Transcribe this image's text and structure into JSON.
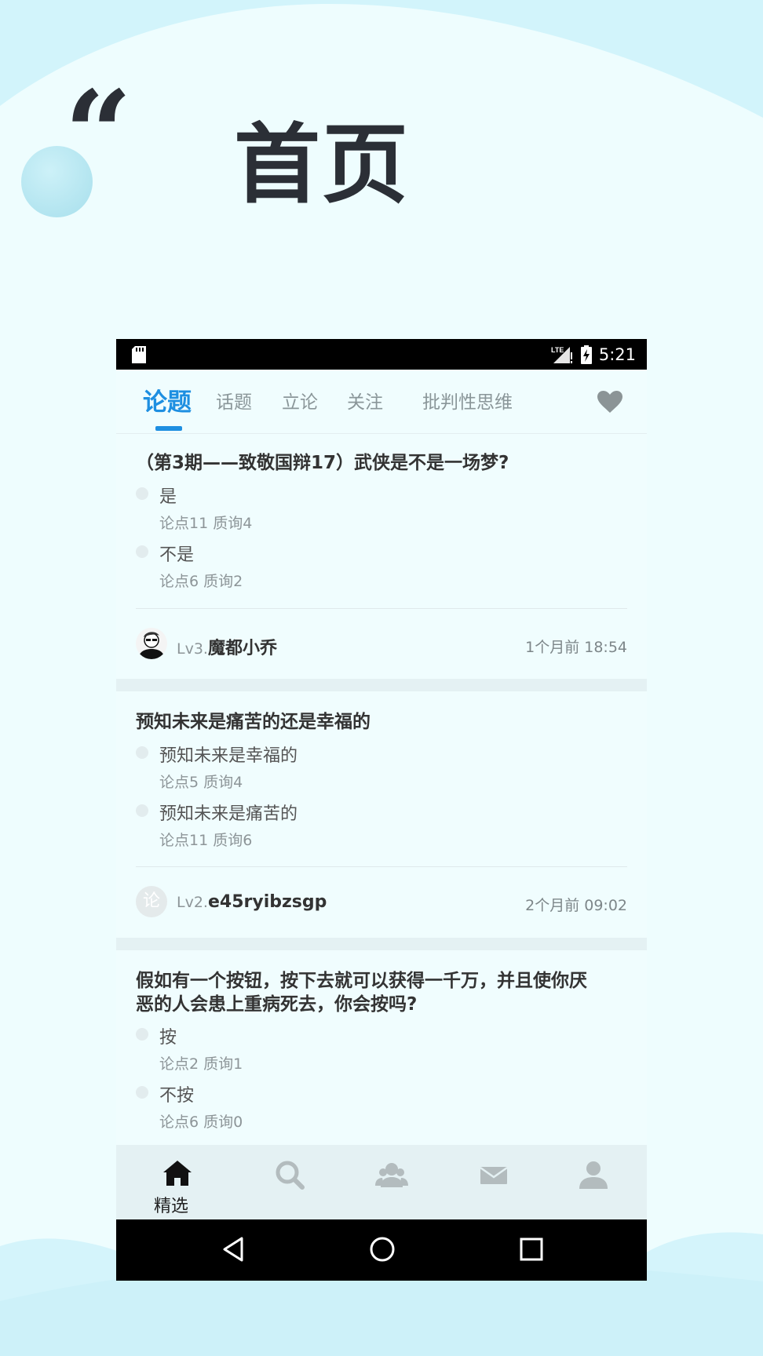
{
  "banner": {
    "quote_mark": "“",
    "title": "首页"
  },
  "status_bar": {
    "network": "LTE",
    "time": "5:21"
  },
  "tabs": [
    {
      "label": "论题",
      "active": true
    },
    {
      "label": "话题",
      "active": false
    },
    {
      "label": "立论",
      "active": false
    },
    {
      "label": "关注",
      "active": false
    },
    {
      "label": "批判性思维",
      "active": false
    }
  ],
  "favorite_icon": "heart-icon",
  "topics": [
    {
      "title": "（第3期——致敬国辩17）武侠是不是一场梦?",
      "options": [
        {
          "label": "是",
          "stats": "论点11 质询4"
        },
        {
          "label": "不是",
          "stats": "论点6 质询2"
        }
      ],
      "author": {
        "level": "Lv3.",
        "name": "魔都小乔"
      },
      "time": "1个月前 18:54"
    },
    {
      "title": "预知未来是痛苦的还是幸福的",
      "options": [
        {
          "label": "预知未来是幸福的",
          "stats": "论点5 质询4"
        },
        {
          "label": "预知未来是痛苦的",
          "stats": "论点11 质询6"
        }
      ],
      "author": {
        "level": "Lv2.",
        "name": "e45ryibzsgp",
        "avatar_char": "论"
      },
      "time": "2个月前 09:02"
    },
    {
      "title_line1": "假如有一个按钮，按下去就可以获得一千万，并且使你厌",
      "title_line2": "恶的人会患上重病死去，你会按吗?",
      "options": [
        {
          "label": "按",
          "stats": "论点2 质询1"
        },
        {
          "label": "不按",
          "stats": "论点6 质询0"
        }
      ]
    }
  ],
  "bottom_nav": [
    {
      "icon": "home-icon",
      "label": "精选",
      "active": true
    },
    {
      "icon": "search-icon"
    },
    {
      "icon": "group-icon"
    },
    {
      "icon": "mail-icon"
    },
    {
      "icon": "profile-icon"
    }
  ],
  "colors": {
    "accent": "#1e8fe1",
    "background": "#eefdfe",
    "title": "#2b2f36"
  }
}
